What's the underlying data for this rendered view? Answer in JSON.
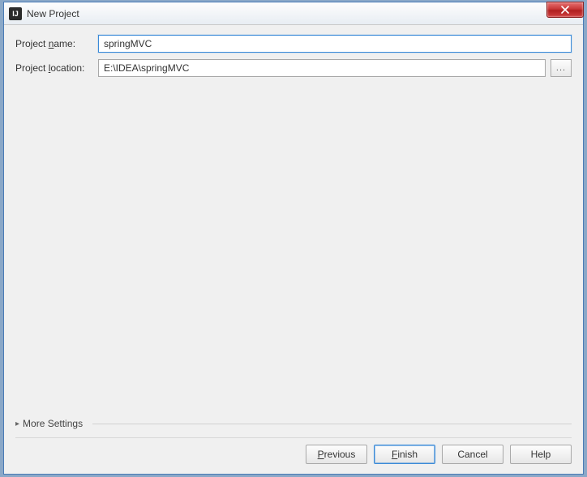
{
  "window": {
    "title": "New Project",
    "app_icon_text": "IJ"
  },
  "form": {
    "name_label_prefix": "Project ",
    "name_label_underline": "n",
    "name_label_suffix": "ame:",
    "name_value": "springMVC",
    "location_label_prefix": "Project ",
    "location_label_underline": "l",
    "location_label_suffix": "ocation:",
    "location_value": "E:\\IDEA\\springMVC",
    "browse_glyph": "..."
  },
  "more_settings": {
    "label": "More Settings"
  },
  "buttons": {
    "previous_u": "P",
    "previous_rest": "revious",
    "finish_u": "F",
    "finish_rest": "inish",
    "cancel": "Cancel",
    "help": "Help"
  }
}
